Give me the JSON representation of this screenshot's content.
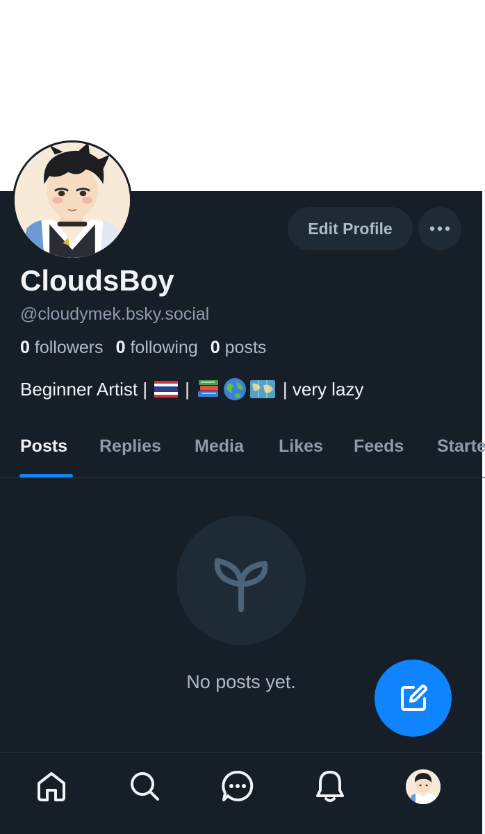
{
  "profile": {
    "display_name": "CloudsBoy",
    "handle": "@cloudymek.bsky.social",
    "followers_count": "0",
    "followers_label": "followers",
    "following_count": "0",
    "following_label": "following",
    "posts_count": "0",
    "posts_label": "posts",
    "bio_start": "Beginner Artist |",
    "bio_sep": "|",
    "bio_end": "| very lazy",
    "bio_emojis": [
      "thailand-flag-icon",
      "books-icon",
      "globe-icon",
      "map-icon"
    ]
  },
  "actions": {
    "edit_profile_label": "Edit Profile",
    "more_icon": "ellipsis-icon"
  },
  "tabs": [
    {
      "label": "Posts",
      "active": true
    },
    {
      "label": "Replies",
      "active": false
    },
    {
      "label": "Media",
      "active": false
    },
    {
      "label": "Likes",
      "active": false
    },
    {
      "label": "Feeds",
      "active": false
    },
    {
      "label": "Starter Packs",
      "active": false
    }
  ],
  "empty_state": {
    "icon": "sprout-icon",
    "message": "No posts yet."
  },
  "fab": {
    "icon": "compose-icon"
  },
  "bottom_nav": [
    {
      "icon": "home-icon"
    },
    {
      "icon": "search-icon"
    },
    {
      "icon": "chat-icon"
    },
    {
      "icon": "bell-icon"
    },
    {
      "icon": "profile-avatar"
    }
  ],
  "colors": {
    "background": "#161e27",
    "accent": "#1083fe",
    "surface": "#1e2a36",
    "muted_text": "#8c9bab"
  }
}
